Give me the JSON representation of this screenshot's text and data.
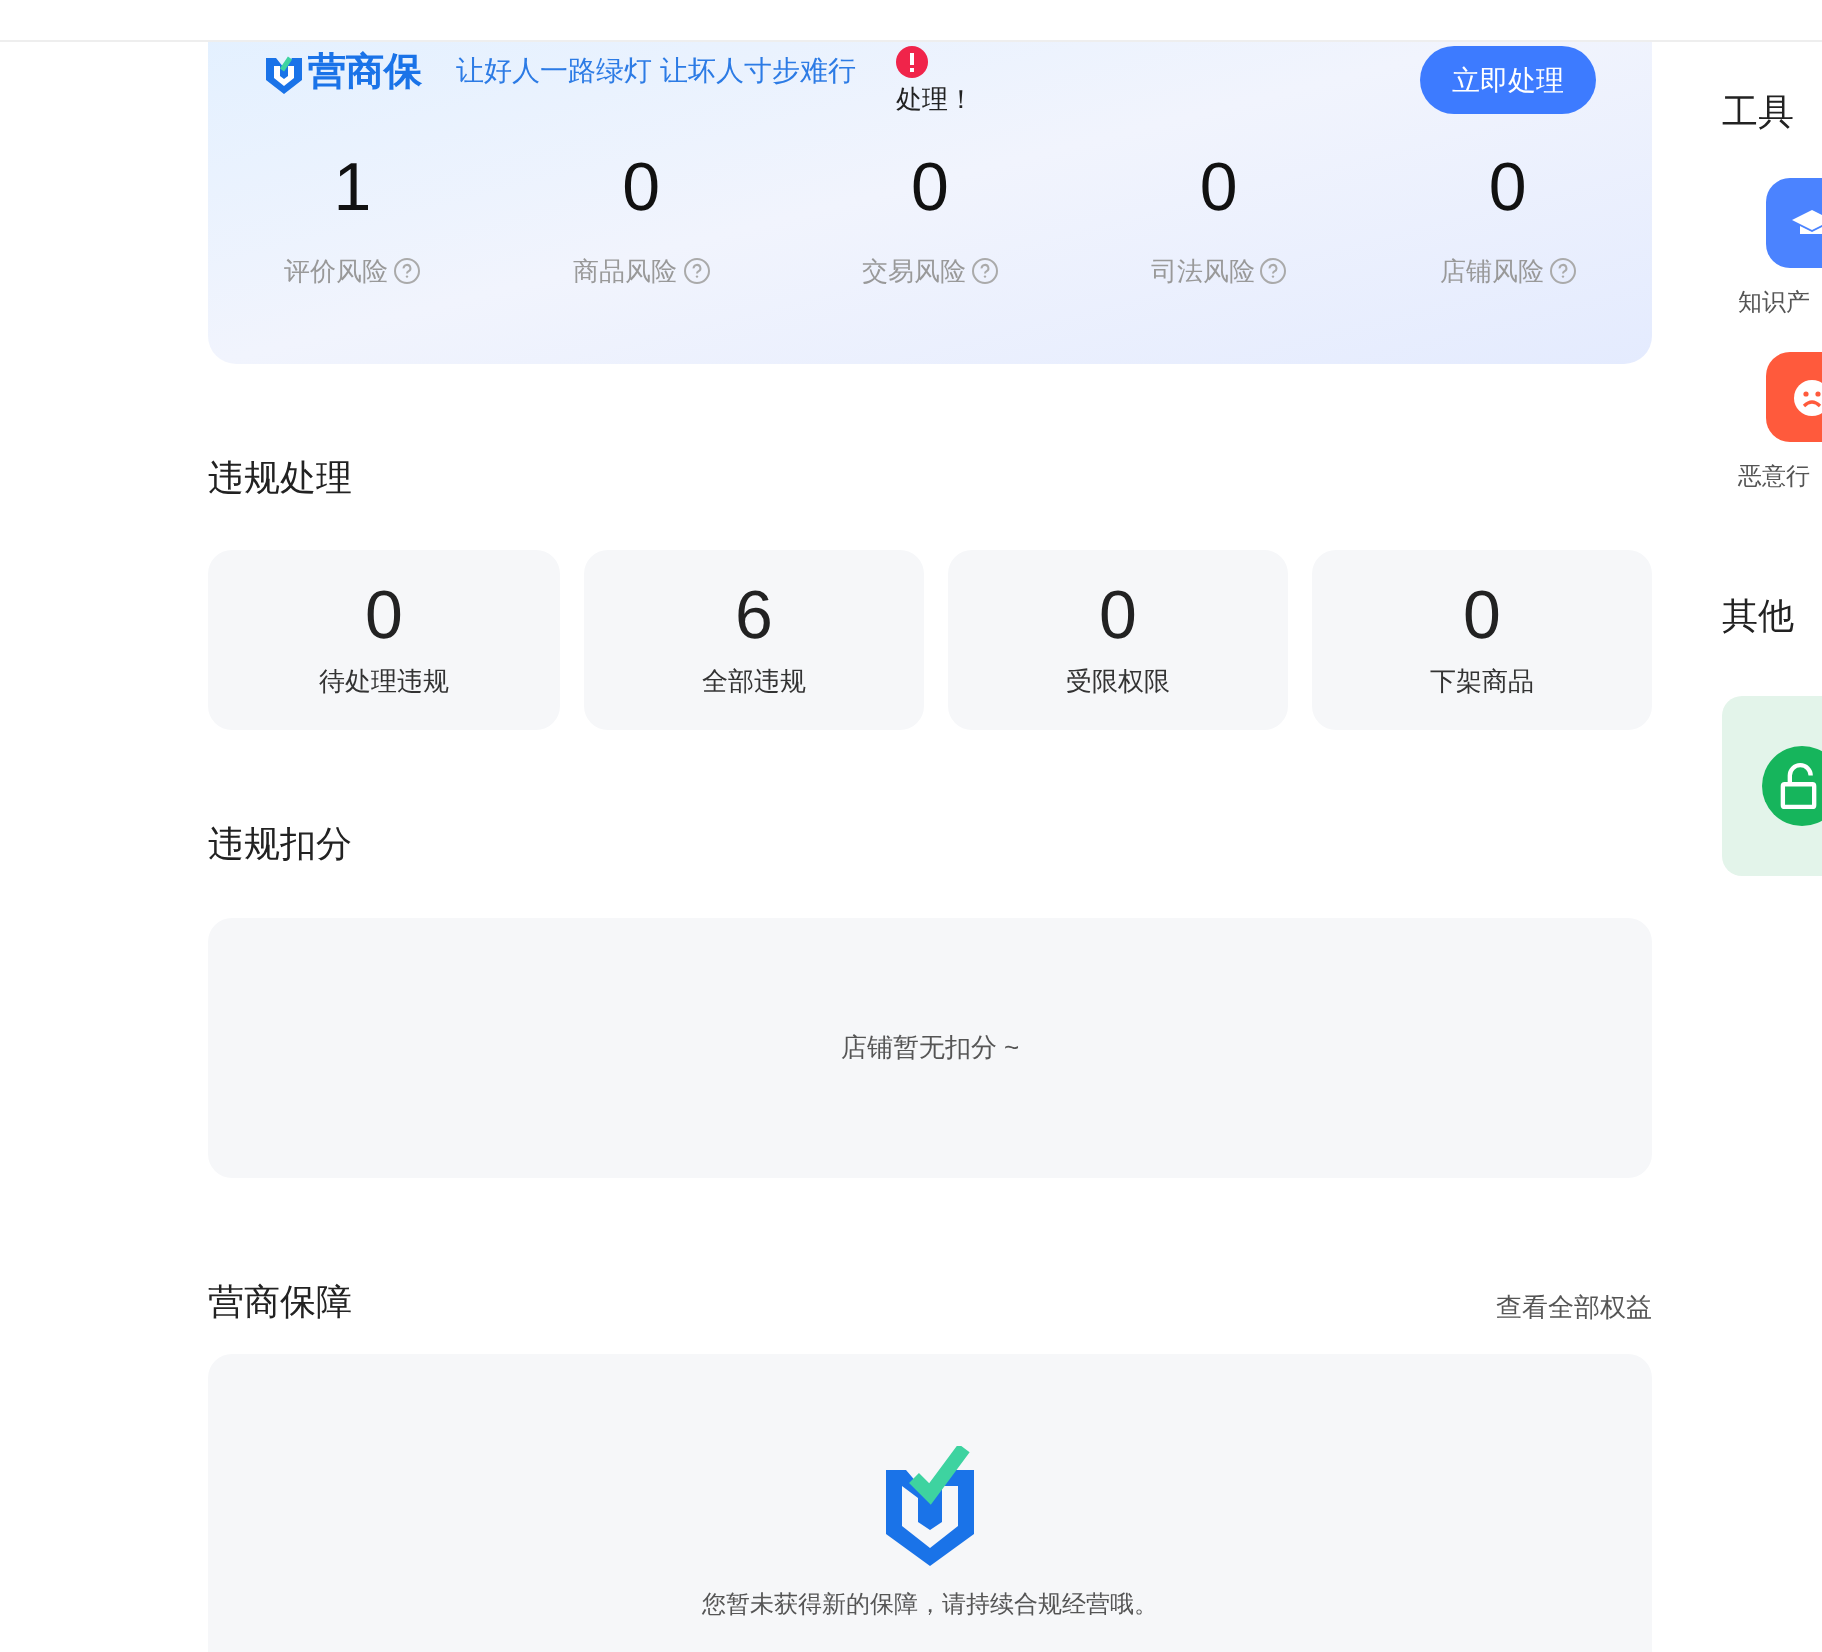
{
  "banner": {
    "brand": "营商保",
    "slogan": "让好人一路绿灯 让坏人寸步难行",
    "notice": "处理！",
    "button": "立即处理",
    "risks": [
      {
        "value": "1",
        "label": "评价风险"
      },
      {
        "value": "0",
        "label": "商品风险"
      },
      {
        "value": "0",
        "label": "交易风险"
      },
      {
        "value": "0",
        "label": "司法风险"
      },
      {
        "value": "0",
        "label": "店铺风险"
      }
    ]
  },
  "violations": {
    "title": "违规处理",
    "items": [
      {
        "value": "0",
        "label": "待处理违规"
      },
      {
        "value": "6",
        "label": "全部违规"
      },
      {
        "value": "0",
        "label": "受限权限"
      },
      {
        "value": "0",
        "label": "下架商品"
      }
    ]
  },
  "deduction": {
    "title": "违规扣分",
    "empty_text": "店铺暂无扣分 ~"
  },
  "guarantee": {
    "title": "营商保障",
    "link": "查看全部权益",
    "empty_text": "您暂未获得新的保障，请持续合规经营哦。"
  },
  "sidebar": {
    "toolbox_title": "工具",
    "tools": [
      {
        "kind": "cap",
        "label": "知识产"
      },
      {
        "kind": "sad",
        "label": "恶意行"
      }
    ],
    "other_title": "其他"
  }
}
